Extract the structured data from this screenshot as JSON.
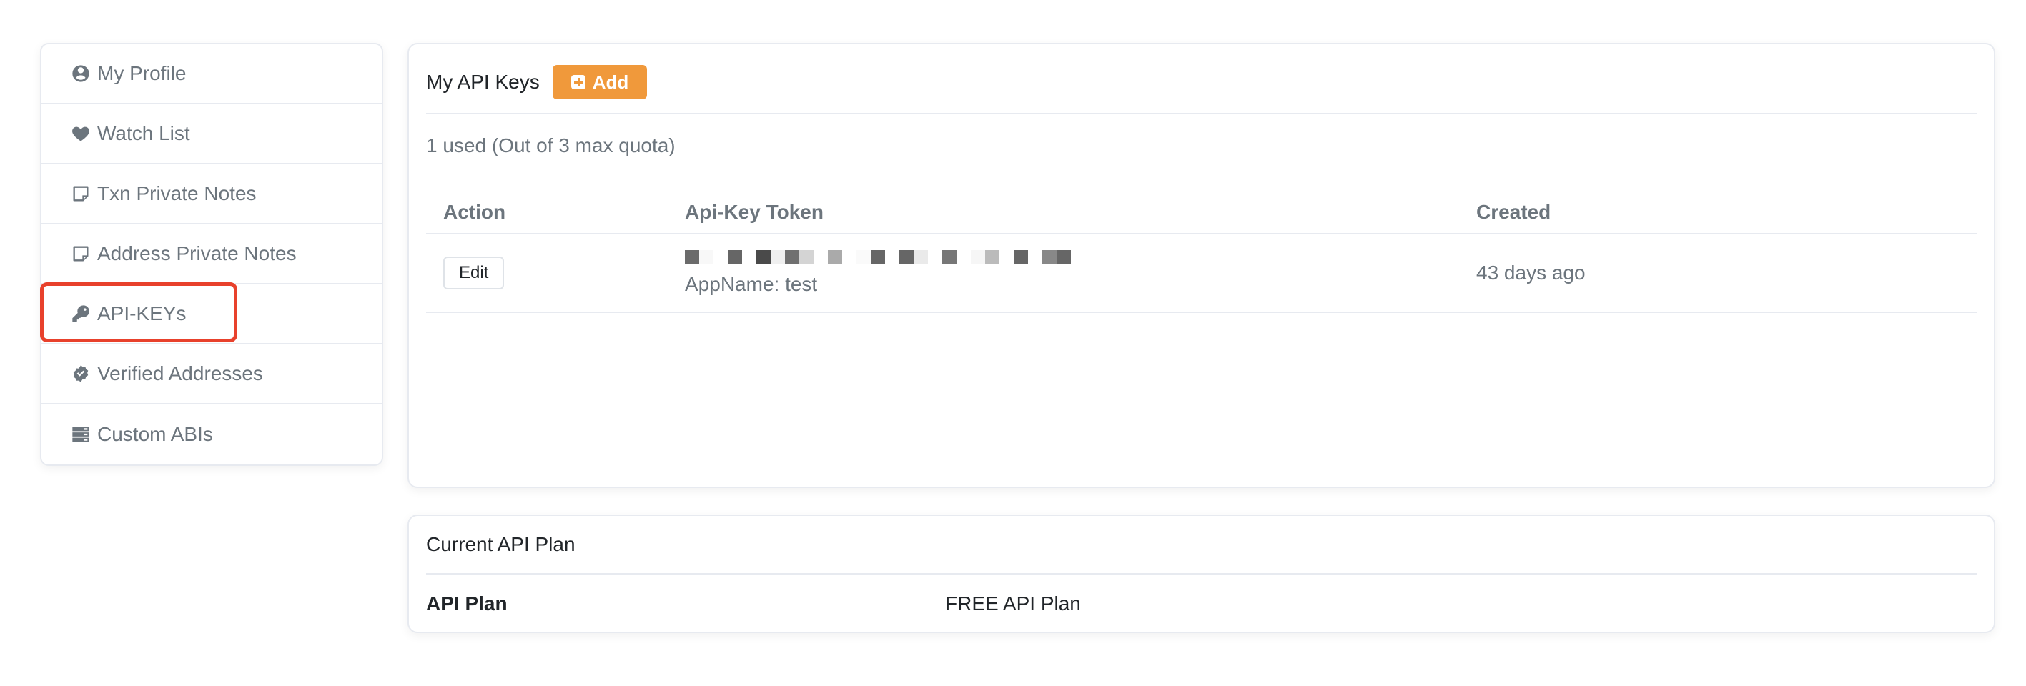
{
  "sidebar": {
    "items": [
      {
        "label": "My Profile",
        "icon": "user-circle-icon"
      },
      {
        "label": "Watch List",
        "icon": "heart-icon"
      },
      {
        "label": "Txn Private Notes",
        "icon": "sticky-note-icon"
      },
      {
        "label": "Address Private Notes",
        "icon": "sticky-note-icon"
      },
      {
        "label": "API-KEYs",
        "icon": "key-icon",
        "active": true
      },
      {
        "label": "Verified Addresses",
        "icon": "badge-check-icon"
      },
      {
        "label": "Custom ABIs",
        "icon": "server-icon"
      }
    ]
  },
  "api_keys": {
    "title": "My API Keys",
    "add_label": "Add",
    "quota_text": "1 used (Out of 3 max quota)",
    "columns": [
      "Action",
      "Api-Key Token",
      "Created"
    ],
    "rows": [
      {
        "action_label": "Edit",
        "token": "[redacted]",
        "app_name": "AppName: test",
        "created": "43 days ago"
      }
    ]
  },
  "plan": {
    "title": "Current API Plan",
    "label": "API Plan",
    "value": "FREE API Plan"
  },
  "colors": {
    "accent": "#f0993b",
    "highlight": "#e8412c",
    "muted_text": "#6c757d"
  }
}
